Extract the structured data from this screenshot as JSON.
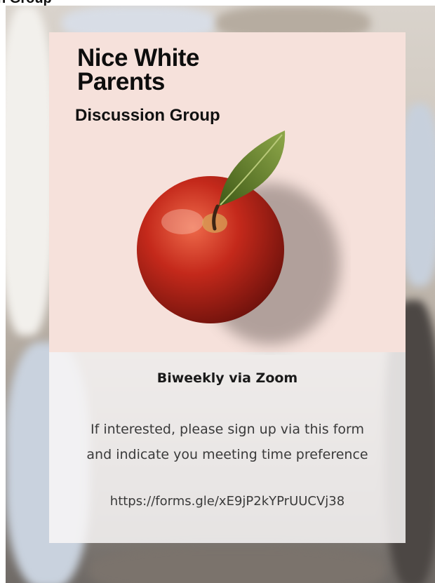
{
  "top_strip": {
    "title": "n Group"
  },
  "flyer": {
    "brand": {
      "line1": "Nice White",
      "line2": "Parents"
    },
    "subtitle": "Discussion Group",
    "schedule": "Biweekly via Zoom",
    "info": {
      "line1": "If interested, please sign up via this form",
      "line2": "and indicate you meeting time preference"
    },
    "form_link": "https://forms.gle/xE9jP2kYPrUUCVj38"
  },
  "colors": {
    "card_top": "#f6e1db",
    "card_bottom": "#f8f6f6",
    "apple_red": "#c0281b",
    "leaf_green": "#5b7a24"
  },
  "icons": {
    "apple": "apple-illustration",
    "leaf": "leaf-icon"
  }
}
